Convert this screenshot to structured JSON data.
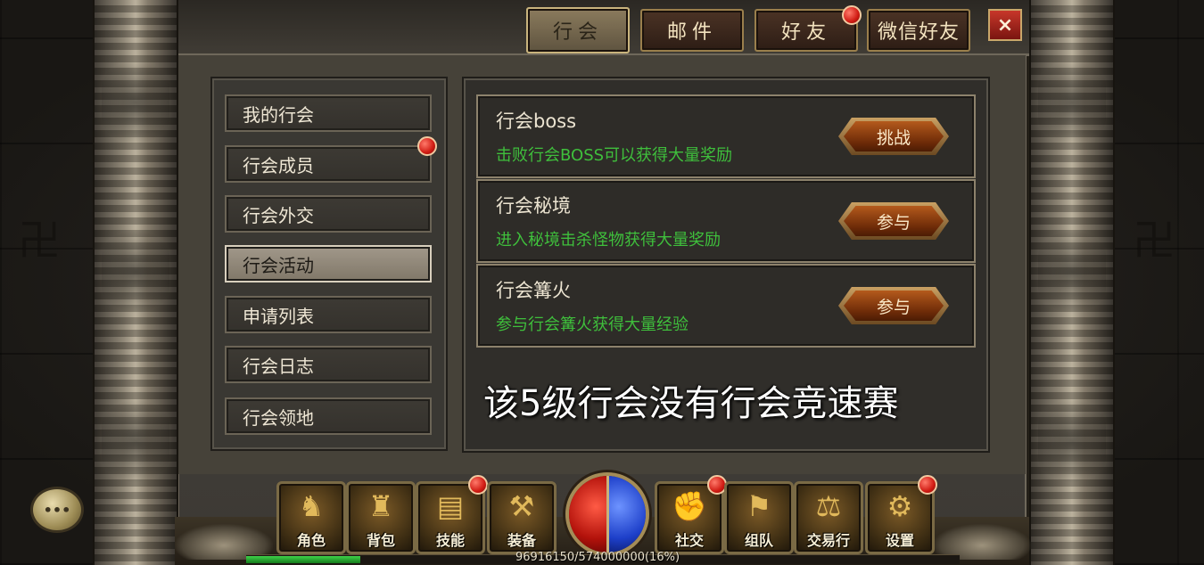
{
  "tabs": [
    {
      "label": "行会",
      "active": true,
      "badge": false
    },
    {
      "label": "邮件",
      "active": false,
      "badge": false
    },
    {
      "label": "好友",
      "active": false,
      "badge": true
    },
    {
      "label": "微信好友",
      "active": false,
      "badge": false
    }
  ],
  "close_label": "×",
  "menu": [
    {
      "label": "我的行会",
      "active": false,
      "badge": false
    },
    {
      "label": "行会成员",
      "active": false,
      "badge": true
    },
    {
      "label": "行会外交",
      "active": false,
      "badge": false
    },
    {
      "label": "行会活动",
      "active": true,
      "badge": false
    },
    {
      "label": "申请列表",
      "active": false,
      "badge": false
    },
    {
      "label": "行会日志",
      "active": false,
      "badge": false
    },
    {
      "label": "行会领地",
      "active": false,
      "badge": false
    }
  ],
  "activities": [
    {
      "title": "行会boss",
      "desc": "击败行会BOSS可以获得大量奖励",
      "button": "挑战"
    },
    {
      "title": "行会秘境",
      "desc": "进入秘境击杀怪物获得大量奖励",
      "button": "参与"
    },
    {
      "title": "行会篝火",
      "desc": "参与行会篝火获得大量经验",
      "button": "参与"
    }
  ],
  "caption": "该5级行会没有行会竞速赛",
  "chat_icon": "chat-bubble-icon",
  "hud_buttons": [
    {
      "label": "角色",
      "icon": "character-icon",
      "badge": false
    },
    {
      "label": "背包",
      "icon": "bag-icon",
      "badge": false
    },
    {
      "label": "技能",
      "icon": "book-icon",
      "badge": true
    },
    {
      "label": "装备",
      "icon": "equipment-icon",
      "badge": false
    },
    {
      "label": "社交",
      "icon": "social-icon",
      "badge": true
    },
    {
      "label": "组队",
      "icon": "team-icon",
      "badge": false
    },
    {
      "label": "交易行",
      "icon": "trade-icon",
      "badge": false
    },
    {
      "label": "设置",
      "icon": "gear-icon",
      "badge": true
    }
  ],
  "exp_text": "96916150/574000000(16%)",
  "exp_fraction": 0.16,
  "colors": {
    "accent_green": "#3fbf3c",
    "badge_red": "#d01b13",
    "gold": "#c9a063"
  }
}
